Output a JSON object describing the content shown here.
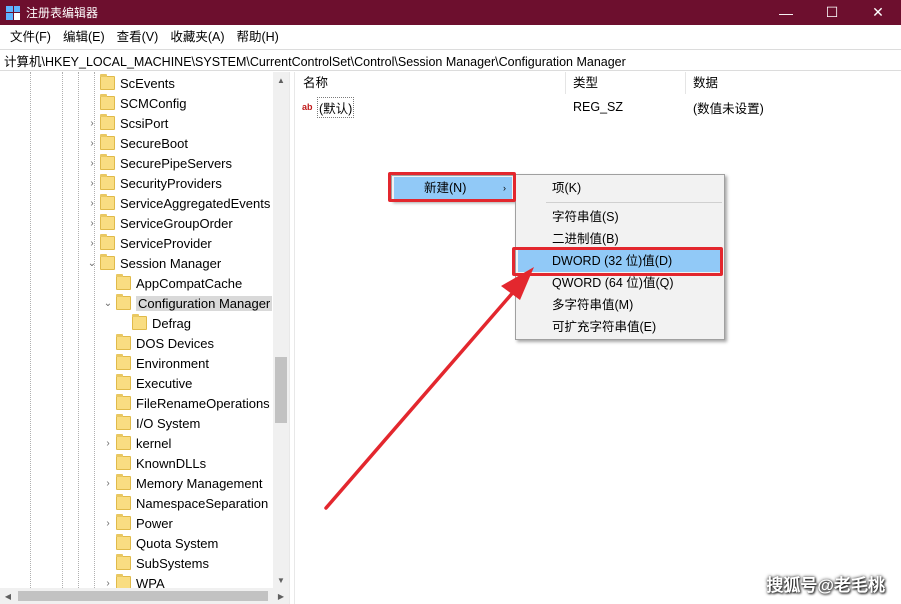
{
  "window": {
    "title": "注册表编辑器",
    "controls": {
      "minimize": "—",
      "maximize": "☐",
      "close": "✕"
    }
  },
  "menu": [
    "文件(F)",
    "编辑(E)",
    "查看(V)",
    "收藏夹(A)",
    "帮助(H)"
  ],
  "address": "计算机\\HKEY_LOCAL_MACHINE\\SYSTEM\\CurrentControlSet\\Control\\Session Manager\\Configuration Manager",
  "tree": {
    "nodes": [
      {
        "label": "ScEvents",
        "expander": ""
      },
      {
        "label": "SCMConfig",
        "expander": ""
      },
      {
        "label": "ScsiPort",
        "expander": "›"
      },
      {
        "label": "SecureBoot",
        "expander": "›"
      },
      {
        "label": "SecurePipeServers",
        "expander": "›"
      },
      {
        "label": "SecurityProviders",
        "expander": "›"
      },
      {
        "label": "ServiceAggregatedEvents",
        "expander": "›"
      },
      {
        "label": "ServiceGroupOrder",
        "expander": "›"
      },
      {
        "label": "ServiceProvider",
        "expander": "›"
      },
      {
        "label": "Session Manager",
        "expander": "⌄"
      },
      {
        "label": "AppCompatCache",
        "expander": ""
      },
      {
        "label": "Configuration Manager",
        "expander": "⌄",
        "selected": true
      },
      {
        "label": "Defrag",
        "expander": ""
      },
      {
        "label": "DOS Devices",
        "expander": ""
      },
      {
        "label": "Environment",
        "expander": ""
      },
      {
        "label": "Executive",
        "expander": ""
      },
      {
        "label": "FileRenameOperations",
        "expander": ""
      },
      {
        "label": "I/O System",
        "expander": ""
      },
      {
        "label": "kernel",
        "expander": "›"
      },
      {
        "label": "KnownDLLs",
        "expander": ""
      },
      {
        "label": "Memory Management",
        "expander": "›"
      },
      {
        "label": "NamespaceSeparation",
        "expander": ""
      },
      {
        "label": "Power",
        "expander": "›"
      },
      {
        "label": "Quota System",
        "expander": ""
      },
      {
        "label": "SubSystems",
        "expander": ""
      },
      {
        "label": "WPA",
        "expander": "›"
      }
    ]
  },
  "list": {
    "columns": [
      "名称",
      "类型",
      "数据"
    ],
    "rows": [
      {
        "icon": "ab",
        "name": "(默认)",
        "type": "REG_SZ",
        "data": "(数值未设置)"
      }
    ]
  },
  "context_menu": {
    "new_label": "新建(N)",
    "submenu_arrow": "›"
  },
  "submenu": {
    "items": [
      "项(K)",
      "字符串值(S)",
      "二进制值(B)",
      "DWORD (32 位)值(D)",
      "QWORD (64 位)值(Q)",
      "多字符串值(M)",
      "可扩充字符串值(E)"
    ]
  },
  "scroll": {
    "up": "▲",
    "down": "▼",
    "left": "◀",
    "right": "▶"
  },
  "watermark": "搜狐号@老毛桃",
  "colors": {
    "titlebar": "#6d0f2e",
    "highlight": "#91c9f7",
    "annotation_red": "#e3272e"
  }
}
